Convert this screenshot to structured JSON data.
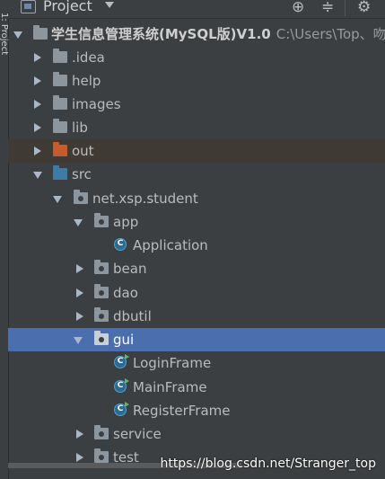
{
  "side_strip": {
    "label": "1: Project"
  },
  "toolbar": {
    "title": "Project",
    "locate_icon": "⊕",
    "collapse_icon": "≑",
    "settings_icon": "⚙"
  },
  "tree": {
    "root": {
      "label": "学生信息管理系统(MySQL版)V1.0",
      "path": "C:\\Users\\Top、吻痕"
    },
    "idea": ".idea",
    "help": "help",
    "images": "images",
    "lib": "lib",
    "out": "out",
    "src": "src",
    "package": "net.xsp.student",
    "app": "app",
    "application": "Application",
    "bean": "bean",
    "dao": "dao",
    "dbutil": "dbutil",
    "gui": "gui",
    "login_frame": "LoginFrame",
    "main_frame": "MainFrame",
    "register_frame": "RegisterFrame",
    "service": "service",
    "test": "test",
    "class_badge": "C"
  },
  "watermark": "https://blog.csdn.net/Stranger_top",
  "colors": {
    "background": "#3c3f41",
    "selection": "#4b6eaf",
    "out_folder": "#c75b2b",
    "src_folder": "#3e7ca8"
  }
}
